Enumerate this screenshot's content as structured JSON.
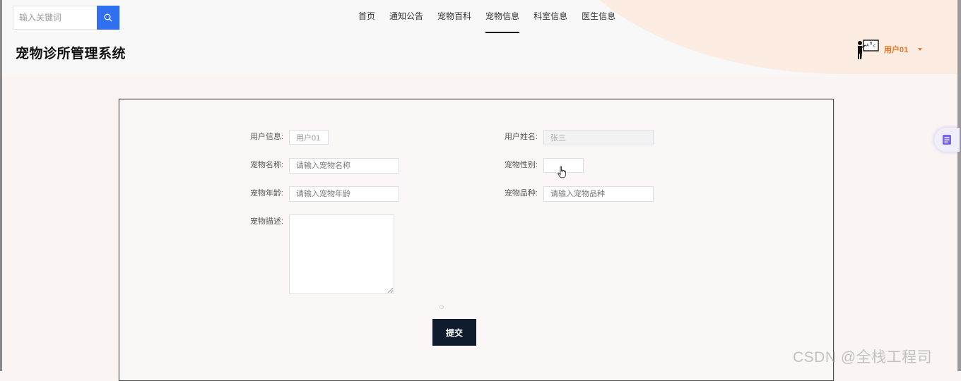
{
  "header": {
    "search_placeholder": "输入关键词",
    "site_title": "宠物诊所管理系统",
    "nav": [
      {
        "label": "首页",
        "active": false
      },
      {
        "label": "通知公告",
        "active": false
      },
      {
        "label": "宠物百科",
        "active": false
      },
      {
        "label": "宠物信息",
        "active": true
      },
      {
        "label": "科室信息",
        "active": false
      },
      {
        "label": "医生信息",
        "active": false
      }
    ],
    "user": {
      "name": "用户01",
      "avatar_icon": "teacher-board-icon"
    }
  },
  "form": {
    "user_info": {
      "label": "用户信息:",
      "value": "用户01"
    },
    "user_name": {
      "label": "用户姓名:",
      "value": "张三"
    },
    "pet_name": {
      "label": "宠物名称:",
      "placeholder": "请输入宠物名称"
    },
    "pet_gender": {
      "label": "宠物性别:",
      "value": ""
    },
    "pet_age": {
      "label": "宠物年龄:",
      "placeholder": "请输入宠物年龄"
    },
    "pet_breed": {
      "label": "宠物品种:",
      "placeholder": "请输入宠物品种"
    },
    "pet_desc": {
      "label": "宠物描述:",
      "value": ""
    },
    "submit_label": "提交"
  },
  "watermark": "CSDN @全栈工程司",
  "colors": {
    "accent_blue": "#2f6ff0",
    "user_orange": "#e8782e",
    "submit_bg": "#0e1c2e"
  }
}
